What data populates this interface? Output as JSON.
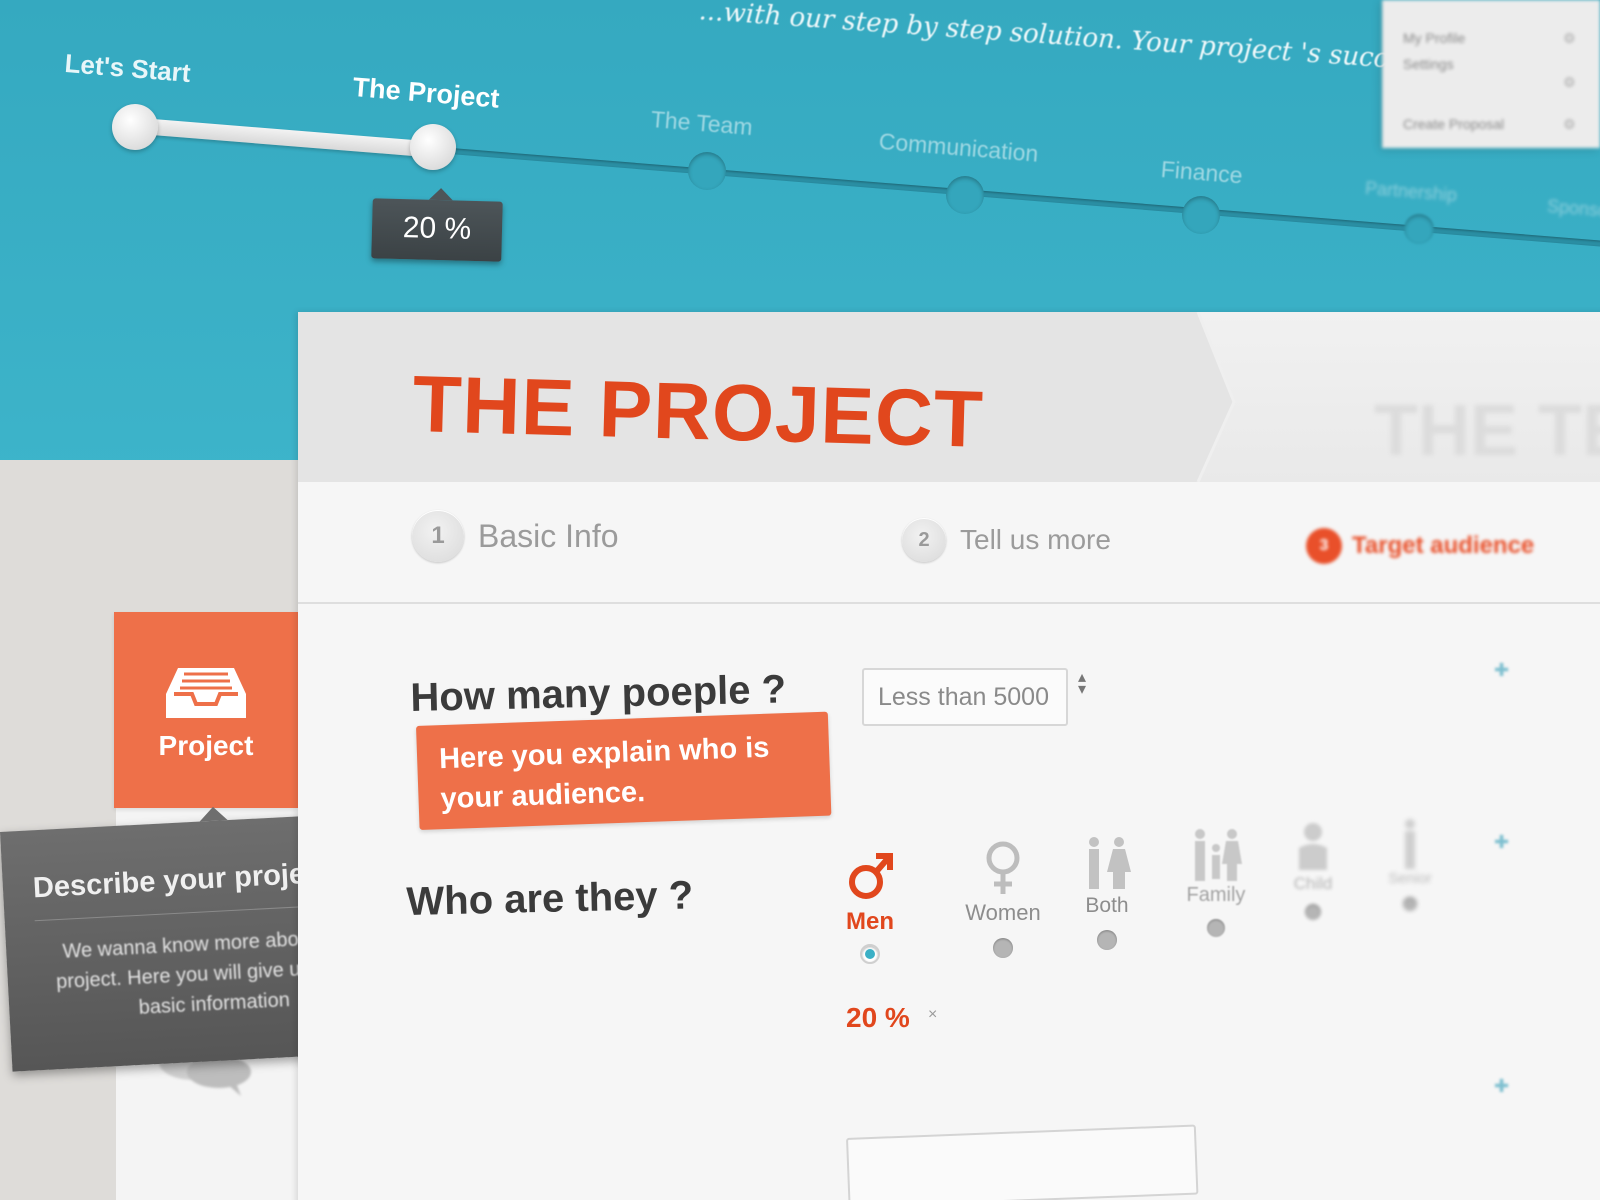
{
  "tagline": "...with our step by step solution. Your project 's success is",
  "account_menu": {
    "items": [
      "My Profile",
      "Settings",
      "Create Proposal"
    ]
  },
  "progress": {
    "value_percent": 20,
    "value_label": "20 %",
    "steps": [
      {
        "label": "Let's Start",
        "state": "done"
      },
      {
        "label": "The Project",
        "state": "current"
      },
      {
        "label": "The Team",
        "state": "upcoming"
      },
      {
        "label": "Communication",
        "state": "upcoming"
      },
      {
        "label": "Finance",
        "state": "upcoming"
      },
      {
        "label": "Partnership",
        "state": "upcoming"
      },
      {
        "label": "Sponsors",
        "state": "upcoming"
      }
    ]
  },
  "sidebar": {
    "active_tab": "Project",
    "tooltip": {
      "title": "Describe your project",
      "body": "We wanna know more about your project. Here you will give us all the basic information"
    }
  },
  "card": {
    "title": "THE PROJECT",
    "next_title": "THE TEAM",
    "substeps": [
      {
        "num": "1",
        "label": "Basic Info"
      },
      {
        "num": "2",
        "label": "Tell us more"
      },
      {
        "num": "3",
        "label": "Target audience"
      }
    ],
    "question_people": "How many poeple ?",
    "people_select_value": "Less than 5000",
    "hint": "Here you explain who is your audience.",
    "question_who": "Who are they ?",
    "audience_options": [
      {
        "label": "Men",
        "selected": true,
        "icon": "male-symbol-icon"
      },
      {
        "label": "Women",
        "selected": false,
        "icon": "female-symbol-icon"
      },
      {
        "label": "Both",
        "selected": false,
        "icon": "couple-icon"
      },
      {
        "label": "Family",
        "selected": false,
        "icon": "family-icon"
      },
      {
        "label": "Child",
        "selected": false,
        "icon": "child-icon"
      },
      {
        "label": "Senior",
        "selected": false,
        "icon": "senior-icon"
      }
    ],
    "men_percent": "20 %",
    "remove_symbol": "×"
  },
  "colors": {
    "teal": "#3bb0c6",
    "orange": "#ee7049",
    "title_red": "#e1471d",
    "dark_tooltip": "#5e5e5e"
  }
}
